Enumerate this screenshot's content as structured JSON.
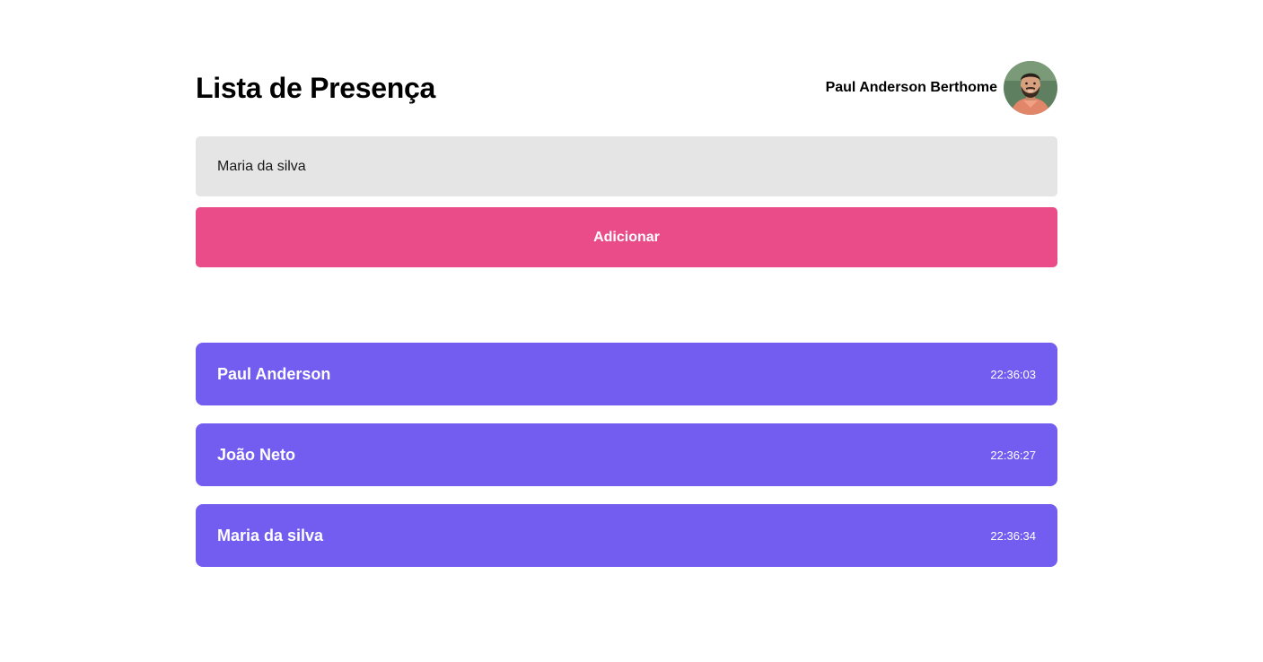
{
  "header": {
    "title": "Lista de Presença",
    "user_name": "Paul Anderson Berthome",
    "avatar_icon": "user-avatar-photo"
  },
  "form": {
    "input_value": "Maria da silva",
    "add_label": "Adicionar"
  },
  "students": [
    {
      "name": "Paul Anderson",
      "time": "22:36:03"
    },
    {
      "name": "João Neto",
      "time": "22:36:27"
    },
    {
      "name": "Maria da silva",
      "time": "22:36:34"
    }
  ],
  "colors": {
    "background": "#ffffff",
    "input_background": "#e5e5e5",
    "button": "#ea4c89",
    "card": "#735cf0",
    "card_text": "#ffffff"
  }
}
